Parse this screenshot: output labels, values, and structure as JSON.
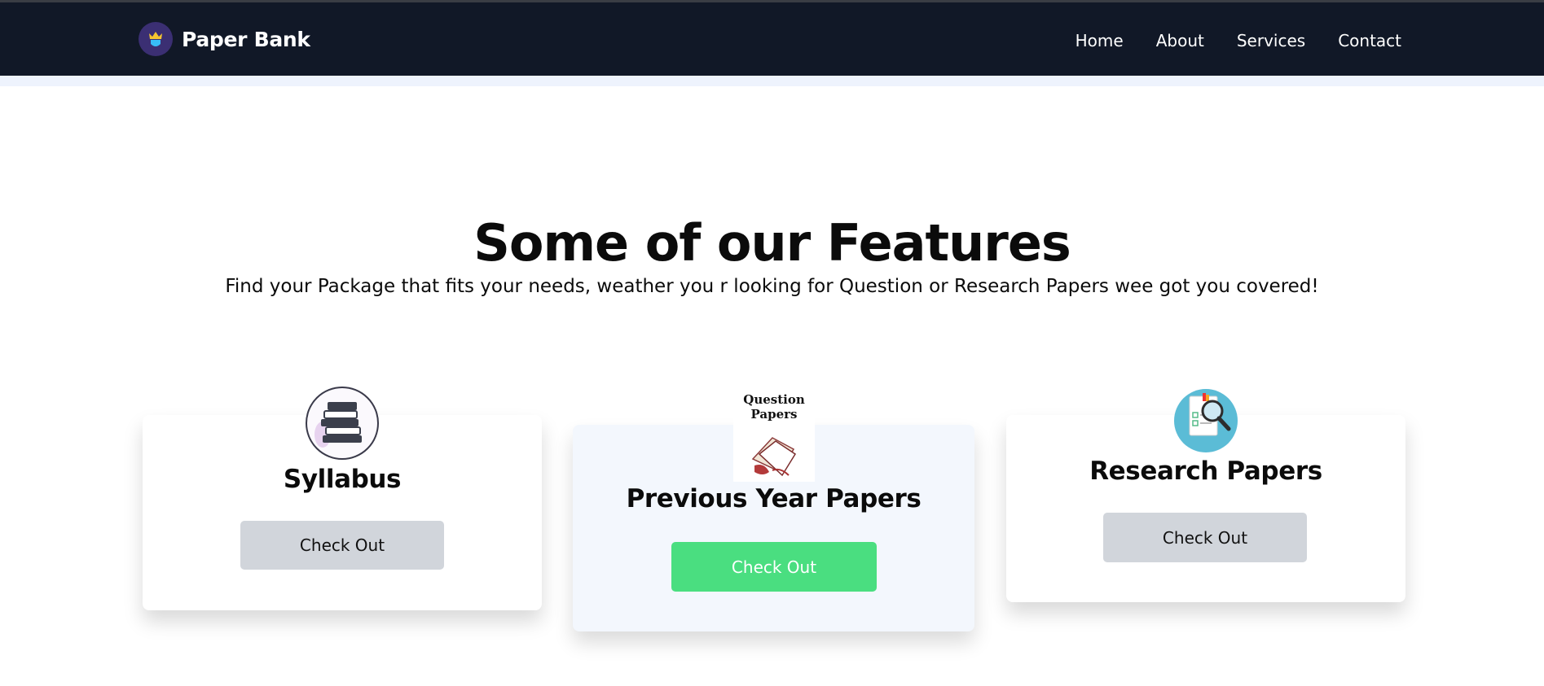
{
  "brand": {
    "name": "Paper Bank",
    "logo_icon": "crown-shield-icon"
  },
  "nav": {
    "items": [
      "Home",
      "About",
      "Services",
      "Contact"
    ]
  },
  "features": {
    "title": "Some of our Features",
    "subtitle": "Find your Package that fits your needs, weather you r looking for Question or Research Papers wee got you covered!"
  },
  "cards": [
    {
      "title": "Syllabus",
      "button": "Check Out",
      "icon": "books-stack-icon",
      "button_style": "grey"
    },
    {
      "title": "Previous Year Papers",
      "button": "Check Out",
      "icon": "question-papers-icon",
      "icon_text": "Question Papers",
      "button_style": "green"
    },
    {
      "title": "Research Papers",
      "button": "Check Out",
      "icon": "magnifier-document-icon",
      "button_style": "grey"
    }
  ],
  "colors": {
    "navbar": "#111827",
    "green_button": "#4ade80",
    "grey_button": "#d1d5db",
    "highlight_card": "#f3f7fd"
  }
}
